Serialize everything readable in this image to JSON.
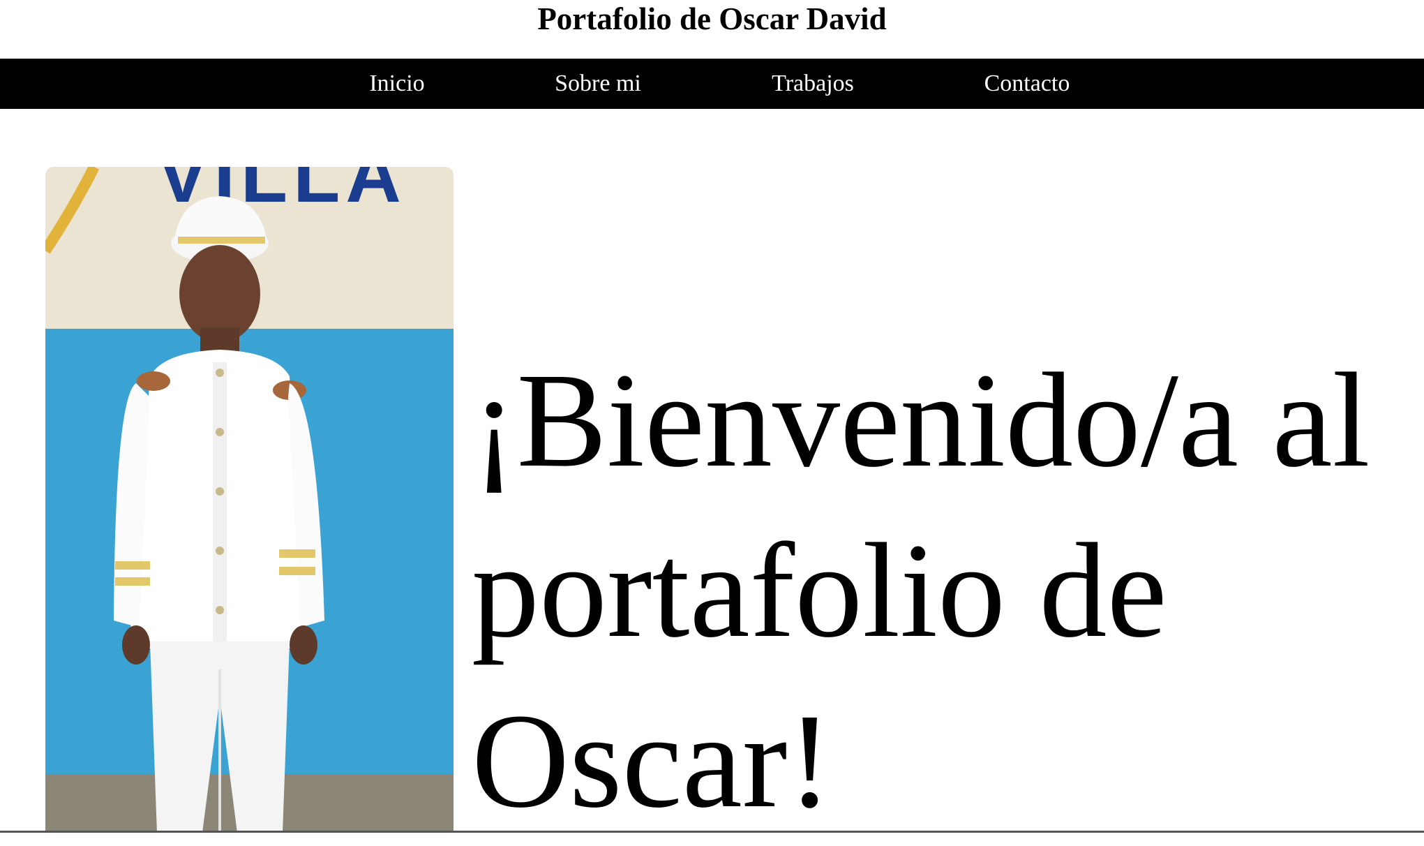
{
  "header": {
    "title": "Portafolio de Oscar David"
  },
  "nav": {
    "items": [
      {
        "label": "Inicio"
      },
      {
        "label": "Sobre mi"
      },
      {
        "label": "Trabajos"
      },
      {
        "label": "Contacto"
      }
    ]
  },
  "hero": {
    "photo_wall_lettering": "VILLA",
    "welcome_text": "¡Bienvenido/a al portafolio de Oscar!"
  },
  "colors": {
    "nav_background": "#000000",
    "nav_text": "#ffffff",
    "page_background": "#ffffff",
    "wall_blue": "#3aa3d4",
    "wall_cream": "#ece4d3"
  }
}
